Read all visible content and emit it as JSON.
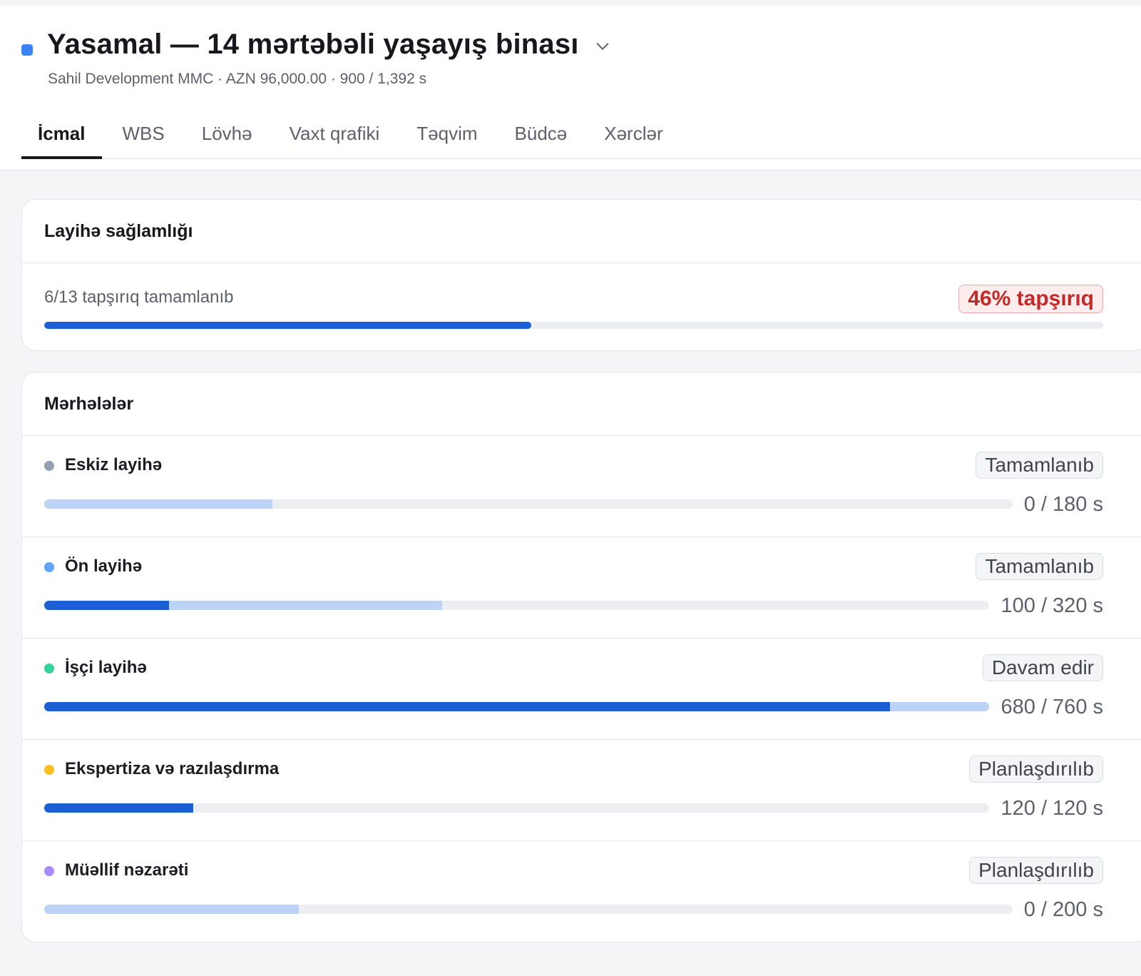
{
  "project": {
    "title": "Yasamal — 14 mərtəbəli yaşayış binası",
    "subtitle": "Sahil Development MMC · AZN 96,000.00 · 900 / 1,392 s",
    "accent_color": "#3b82f6"
  },
  "tabs": [
    {
      "label": "İcmal",
      "active": true
    },
    {
      "label": "WBS",
      "active": false
    },
    {
      "label": "Lövhə",
      "active": false
    },
    {
      "label": "Vaxt qrafiki",
      "active": false
    },
    {
      "label": "Təqvim",
      "active": false
    },
    {
      "label": "Büdcə",
      "active": false
    },
    {
      "label": "Xərclər",
      "active": false
    }
  ],
  "health": {
    "title": "Layihə sağlamlığı",
    "tasks_text": "6/13 tapşırıq tamamlanıb",
    "badge": "46% tapşırıq",
    "progress": 0.46
  },
  "phases_card": {
    "title": "Mərhələlər",
    "items": [
      {
        "name": "Eskiz layihə",
        "dot_color": "#94a0b4",
        "status": "Tamamlanıb",
        "hours": "0 / 180 s",
        "actual": 0.0,
        "planned": 0.236
      },
      {
        "name": "Ön layihə",
        "dot_color": "#60a5fa",
        "status": "Tamamlanıb",
        "hours": "100 / 320 s",
        "actual": 0.132,
        "planned": 0.421
      },
      {
        "name": "İşçi layihə",
        "dot_color": "#34d399",
        "status": "Davam edir",
        "hours": "680 / 760 s",
        "actual": 0.895,
        "planned": 1.0
      },
      {
        "name": "Ekspertiza və razılaşdırma",
        "dot_color": "#fbbf24",
        "status": "Planlaşdırılıb",
        "hours": "120 / 120 s",
        "actual": 0.158,
        "planned": 0.158
      },
      {
        "name": "Müəllif nəzarəti",
        "dot_color": "#a78bfa",
        "status": "Planlaşdırılıb",
        "hours": "0 / 200 s",
        "actual": 0.0,
        "planned": 0.263
      }
    ]
  }
}
